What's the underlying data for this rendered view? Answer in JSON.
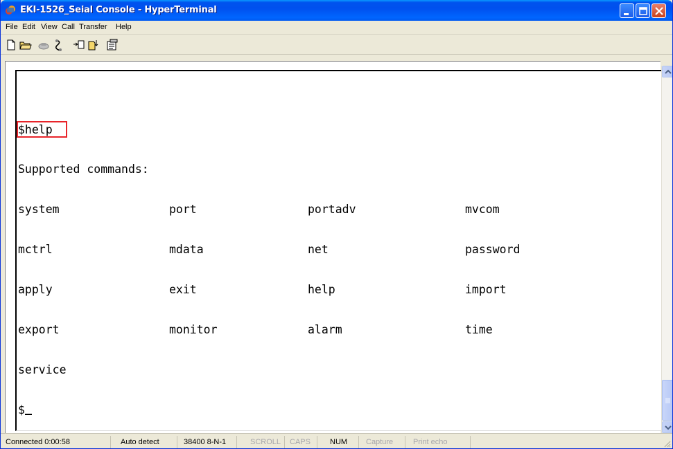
{
  "window": {
    "title": "EKI-1526_Seial Console - HyperTerminal"
  },
  "menu": {
    "items": [
      "File",
      "Edit",
      "View",
      "Call",
      "Transfer",
      "Help"
    ]
  },
  "toolbar": {
    "buttons": [
      "new-icon",
      "open-icon",
      "connect-icon",
      "disconnect-icon",
      "send-icon",
      "receive-icon",
      "properties-icon"
    ]
  },
  "terminal": {
    "prompt_command": "$help",
    "header": "Supported commands:",
    "commands": [
      [
        "system",
        "port",
        "portadv",
        "mvcom"
      ],
      [
        "mctrl",
        "mdata",
        "net",
        "password"
      ],
      [
        "apply",
        "exit",
        "help",
        "import"
      ],
      [
        "export",
        "monitor",
        "alarm",
        "time"
      ],
      [
        "service"
      ]
    ],
    "prompt": "$",
    "highlight_color": "#e8242a"
  },
  "statusbar": {
    "connected": "Connected 0:00:58",
    "detect": "Auto detect",
    "settings": "38400 8-N-1",
    "scroll": "SCROLL",
    "caps": "CAPS",
    "num": "NUM",
    "capture": "Capture",
    "print_echo": "Print echo"
  },
  "colors": {
    "titlebar": "#0053ee",
    "chrome": "#ece9d8"
  }
}
